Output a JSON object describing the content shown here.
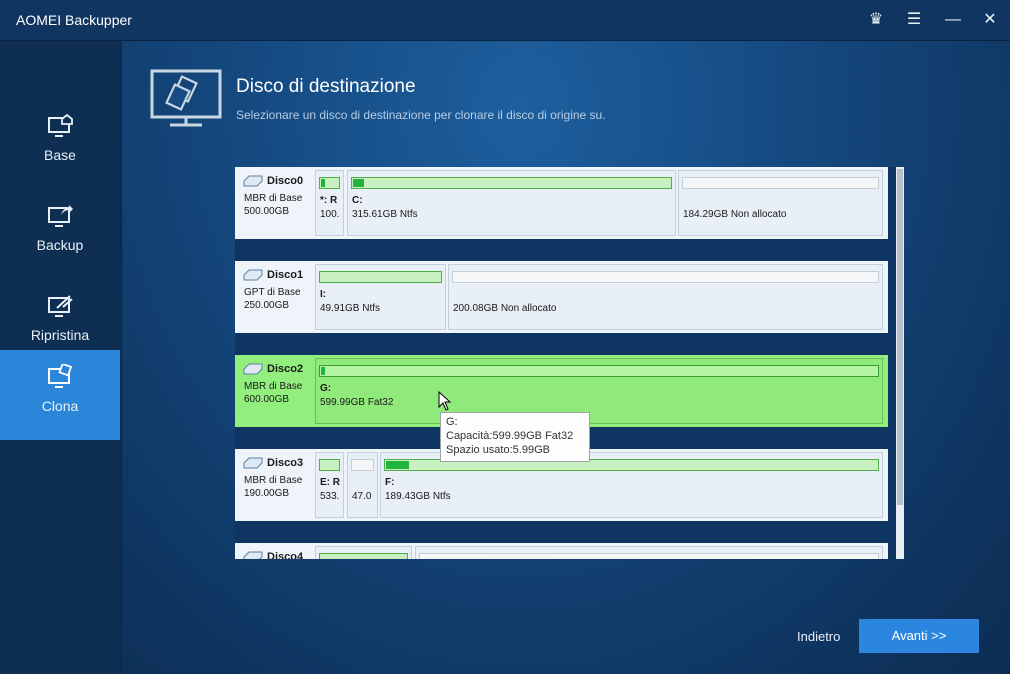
{
  "app": {
    "title": "AOMEI Backupper",
    "controls": [
      {
        "name": "crown-icon",
        "glyph": "♛"
      },
      {
        "name": "menu-icon",
        "glyph": "☰"
      },
      {
        "name": "minimize-icon",
        "glyph": "—"
      },
      {
        "name": "close-icon",
        "glyph": "✕"
      }
    ]
  },
  "sidebar": {
    "items": [
      {
        "label": "Base",
        "icon": "monitor-home-icon",
        "active": false
      },
      {
        "label": "Backup",
        "icon": "monitor-share-icon",
        "active": false
      },
      {
        "label": "Ripristina",
        "icon": "monitor-restore-icon",
        "active": false
      },
      {
        "label": "Clona",
        "icon": "monitor-clone-icon",
        "active": true
      }
    ]
  },
  "header": {
    "title": "Disco di destinazione",
    "subtitle": "Selezionare un disco di destinazione per clonare il disco di origine su.",
    "icon": "disk-clone-icon"
  },
  "disks": [
    {
      "name": "Disco0",
      "type": "MBR di Base",
      "size": "500.00GB",
      "selected": false,
      "partitions": [
        {
          "label": "*: R",
          "info": "100.",
          "fill": 0.3,
          "unallocated": false
        },
        {
          "label": "C:",
          "info": "315.61GB Ntfs",
          "fill": 0.04,
          "unallocated": false
        },
        {
          "label": "",
          "info": "184.29GB Non allocato",
          "fill": 0,
          "unallocated": true
        }
      ]
    },
    {
      "name": "Disco1",
      "type": "GPT di Base",
      "size": "250.00GB",
      "selected": false,
      "partitions": [
        {
          "label": "I:",
          "info": "49.91GB Ntfs",
          "fill": 0,
          "unallocated": false
        },
        {
          "label": "",
          "info": "200.08GB Non allocato",
          "fill": 0,
          "unallocated": true
        }
      ]
    },
    {
      "name": "Disco2",
      "type": "MBR di Base",
      "size": "600.00GB",
      "selected": true,
      "partitions": [
        {
          "label": "G:",
          "info": "599.99GB Fat32",
          "fill": 0.01,
          "unallocated": false
        }
      ]
    },
    {
      "name": "Disco3",
      "type": "MBR di Base",
      "size": "190.00GB",
      "selected": false,
      "partitions": [
        {
          "label": "E: R",
          "info": "533.",
          "fill": 0,
          "unallocated": false
        },
        {
          "label": "",
          "info": "47.0",
          "fill": 0,
          "unallocated": true
        },
        {
          "label": "F:",
          "info": "189.43GB Ntfs",
          "fill": 0.05,
          "unallocated": false
        }
      ]
    },
    {
      "name": "Disco4",
      "type": "",
      "size": "",
      "selected": false,
      "partitions": [
        {
          "label": "",
          "info": "",
          "fill": 0,
          "unallocated": false
        },
        {
          "label": "",
          "info": "",
          "fill": 0,
          "unallocated": true
        }
      ]
    }
  ],
  "tooltip": {
    "line1": "G:",
    "line2": "Capacità:599.99GB Fat32",
    "line3": "Spazio usato:5.99GB"
  },
  "footer": {
    "back_label": "Indietro",
    "next_label": "Avanti >>"
  }
}
